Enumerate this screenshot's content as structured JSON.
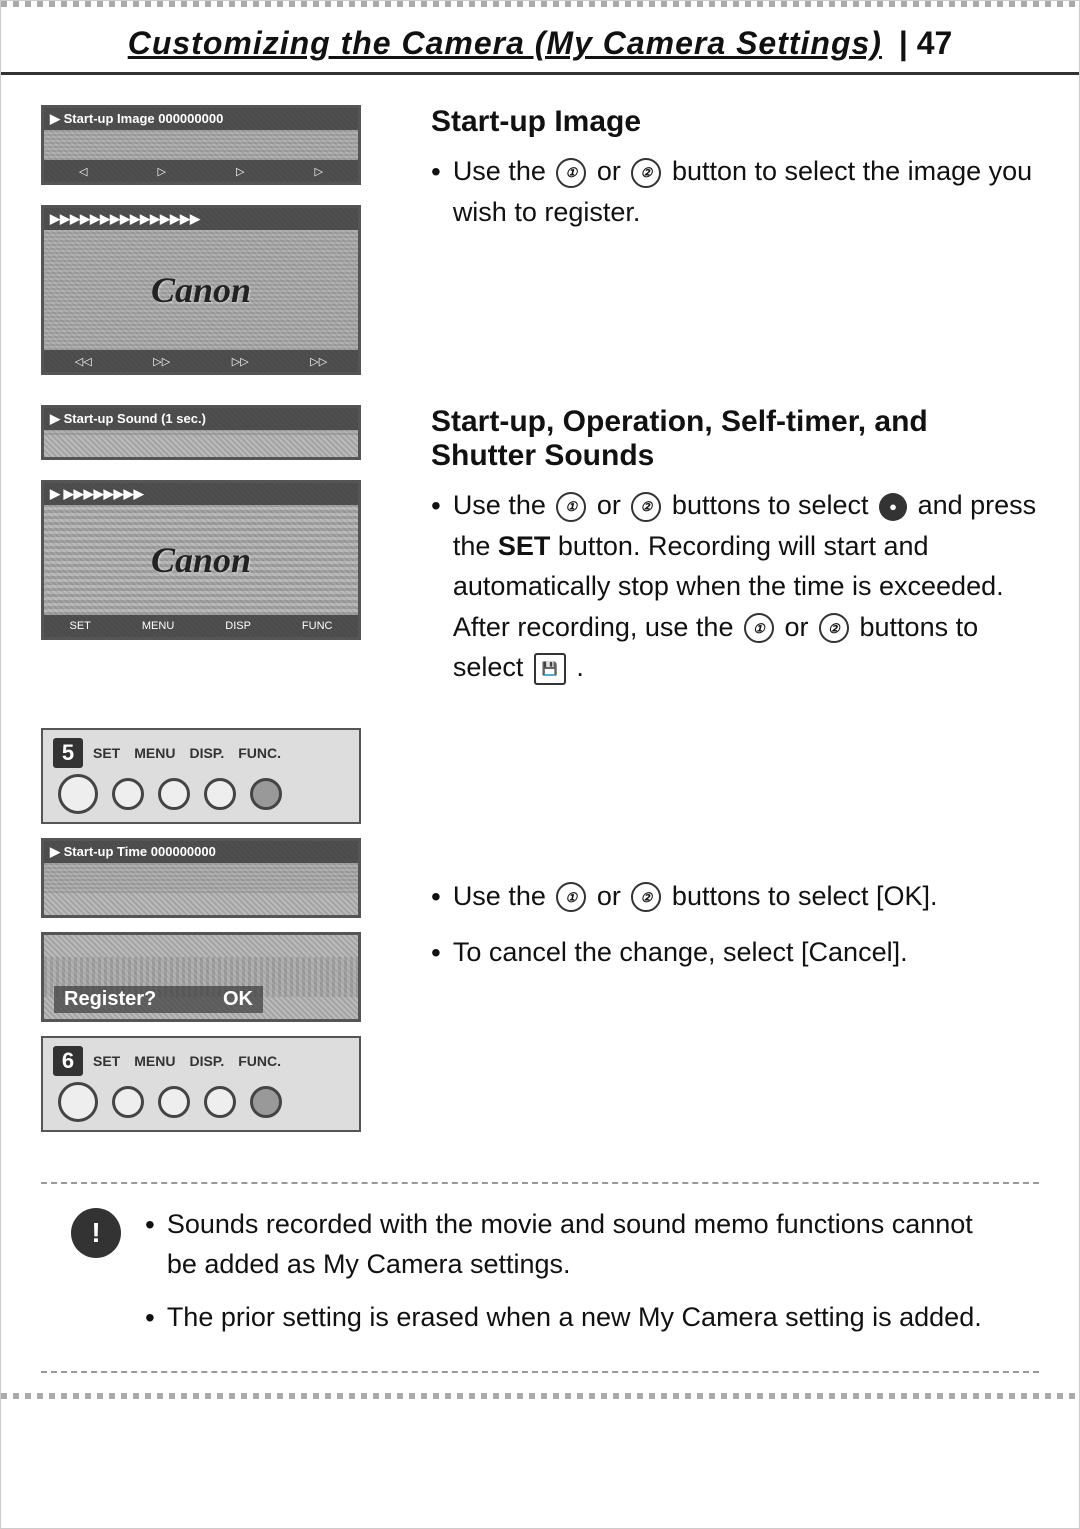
{
  "page": {
    "title": "Customizing the Camera (My Camera Settings)",
    "separator": "I",
    "page_number": "47"
  },
  "sections": {
    "startup_image": {
      "title": "Start-up Image",
      "bullets": [
        {
          "text_before": "Use the",
          "icon1": "①",
          "connector": "or",
          "icon2": "②",
          "text_after": "button to select the image you wish to register."
        }
      ]
    },
    "startup_sounds": {
      "title": "Start-up, Operation, Self-timer, and Shutter Sounds",
      "bullets": [
        {
          "text_before": "Use the",
          "icon1": "①",
          "connector": "or",
          "icon2": "②",
          "text_after": "buttons to select",
          "icon3": "●",
          "text_after2": "and press the",
          "bold": "SET",
          "text_after3": "button. Recording will start and automatically stop when the time is exceeded. After recording, use the",
          "icon4": "①",
          "connector2": "or",
          "icon5": "②",
          "text_after4": "buttons to select",
          "icon6": "▶"
        }
      ]
    },
    "steps": {
      "bullets": [
        {
          "text_before": "Use the",
          "icon1": "①",
          "connector": "or",
          "icon2": "②",
          "text_after": "buttons to select [OK]."
        },
        {
          "text_before": "To cancel the change, select [Cancel]."
        }
      ]
    },
    "note": {
      "bullets": [
        "Sounds recorded with the movie and sound memo functions cannot be added as My Camera settings.",
        "The prior setting is erased when a new My Camera setting is added."
      ]
    }
  },
  "screens": {
    "screen1_top_label": "▶ Start-up Image 000000000",
    "screen2_top_label": "▶ Start-up Sound (1 sec.)",
    "canon_text": "Canon",
    "screen3_step": "5",
    "screen3_labels": [
      "SET",
      "MENU",
      "DISP.",
      "FUNC."
    ],
    "screen4_top_label": "▶ Start-up Time 000000000",
    "screen5_register": "Register?",
    "screen5_ok": "OK",
    "screen6_step": "6",
    "screen6_labels": [
      "SET",
      "MENU",
      "DISP.",
      "FUNC."
    ]
  },
  "note_icon": "!",
  "icons": {
    "btn1": "ⓘ",
    "btn2": "Ⓙ",
    "circle_filled": "●",
    "save_icon": "▶"
  }
}
